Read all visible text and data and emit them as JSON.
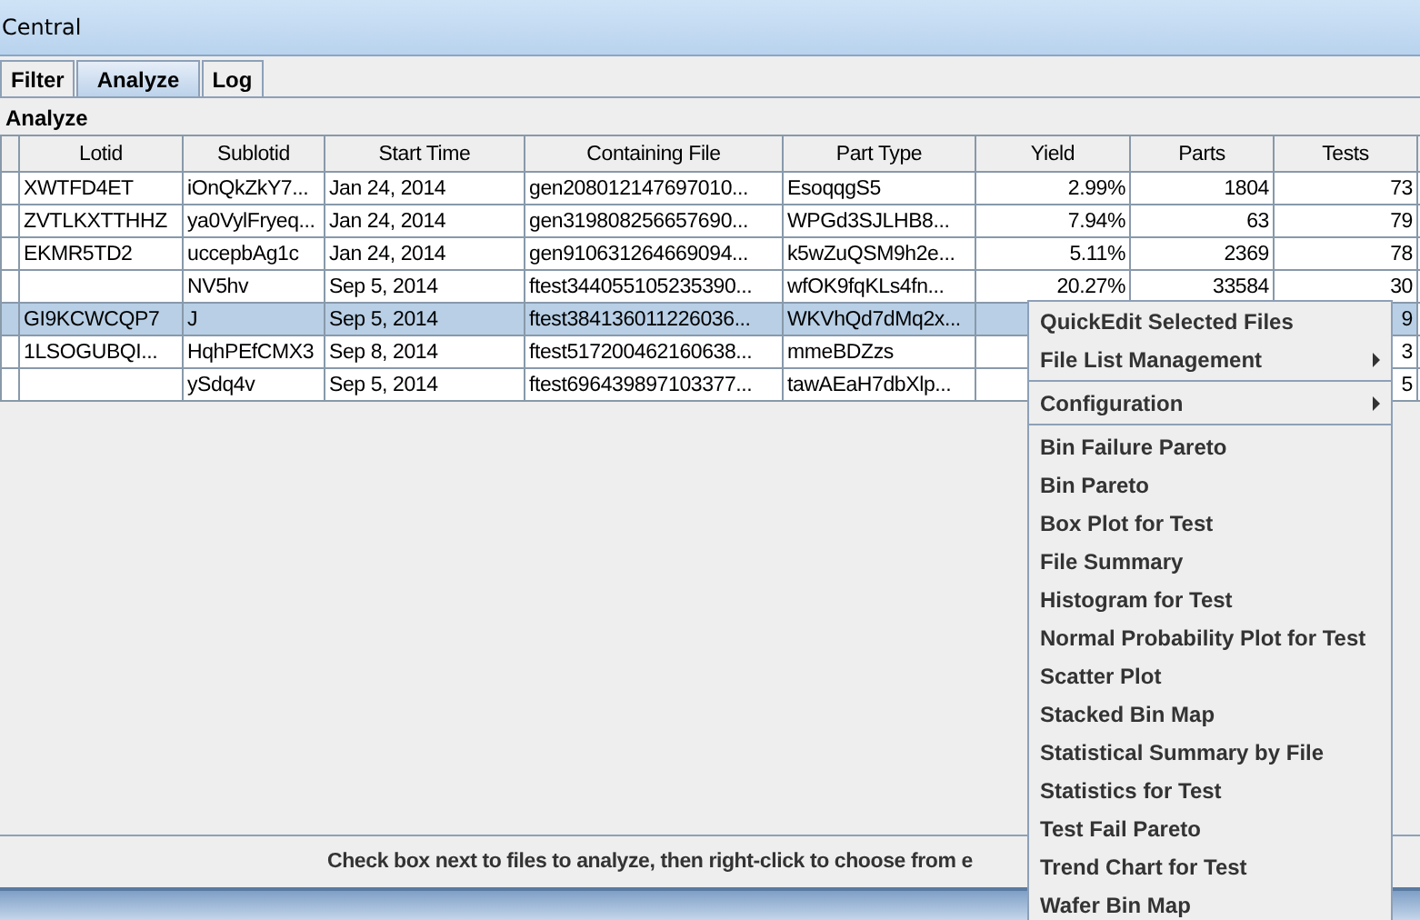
{
  "window": {
    "title": "Central"
  },
  "tabs": [
    {
      "label": "Filter",
      "selected": false
    },
    {
      "label": "Analyze",
      "selected": true
    },
    {
      "label": "Log",
      "selected": false
    }
  ],
  "panel": {
    "title": "Analyze"
  },
  "table": {
    "columns": [
      "Lotid",
      "Sublotid",
      "Start Time",
      "Containing File",
      "Part Type",
      "Yield",
      "Parts",
      "Tests"
    ],
    "rows": [
      {
        "selected": false,
        "cells": [
          "XWTFD4ET",
          "iOnQkZkY7...",
          "Jan 24, 2014",
          "gen208012147697010...",
          "EsoqqgS5",
          "2.99%",
          "1804",
          "73"
        ]
      },
      {
        "selected": false,
        "cells": [
          "ZVTLKXTTHHZ",
          "ya0VylFryeq...",
          "Jan 24, 2014",
          "gen319808256657690...",
          "WPGd3SJLHB8...",
          "7.94%",
          "63",
          "79"
        ]
      },
      {
        "selected": false,
        "cells": [
          "EKMR5TD2",
          "uccepbAg1c",
          "Jan 24, 2014",
          "gen910631264669094...",
          "k5wZuQSM9h2e...",
          "5.11%",
          "2369",
          "78"
        ]
      },
      {
        "selected": false,
        "cells": [
          "",
          "NV5hv",
          "Sep 5, 2014",
          "ftest344055105235390...",
          "wfOK9fqKLs4fn...",
          "20.27%",
          "33584",
          "30"
        ]
      },
      {
        "selected": true,
        "cells": [
          "GI9KCWCQP7",
          "J",
          "Sep 5, 2014",
          "ftest384136011226036...",
          "WKVhQd7dMq2x...",
          "",
          "",
          "9"
        ]
      },
      {
        "selected": false,
        "cells": [
          "1LSOGUBQI...",
          "HqhPEfCMX3",
          "Sep 8, 2014",
          "ftest517200462160638...",
          "mmeBDZzs",
          "",
          "",
          "3"
        ]
      },
      {
        "selected": false,
        "cells": [
          "",
          "ySdq4v",
          "Sep 5, 2014",
          "ftest696439897103377...",
          "tawAEaH7dbXlp...",
          "",
          "",
          "5"
        ]
      }
    ]
  },
  "status_bar": "Check box next to files to analyze, then right-click to choose from e",
  "context_menu": [
    {
      "label": "QuickEdit Selected Files",
      "kind": "item"
    },
    {
      "label": "File List Management",
      "kind": "submenu"
    },
    {
      "kind": "separator"
    },
    {
      "label": "Configuration",
      "kind": "submenu"
    },
    {
      "kind": "separator"
    },
    {
      "label": "Bin Failure Pareto",
      "kind": "item"
    },
    {
      "label": "Bin Pareto",
      "kind": "item"
    },
    {
      "label": "Box Plot for Test",
      "kind": "item"
    },
    {
      "label": "File Summary",
      "kind": "item"
    },
    {
      "label": "Histogram for Test",
      "kind": "item"
    },
    {
      "label": "Normal Probability Plot for Test",
      "kind": "item"
    },
    {
      "label": "Scatter Plot",
      "kind": "item"
    },
    {
      "label": "Stacked Bin Map",
      "kind": "item"
    },
    {
      "label": "Statistical Summary by File",
      "kind": "item"
    },
    {
      "label": "Statistics for Test",
      "kind": "item"
    },
    {
      "label": "Test Fail Pareto",
      "kind": "item"
    },
    {
      "label": "Trend Chart for Test",
      "kind": "item"
    },
    {
      "label": "Wafer Bin Map",
      "kind": "item"
    }
  ]
}
